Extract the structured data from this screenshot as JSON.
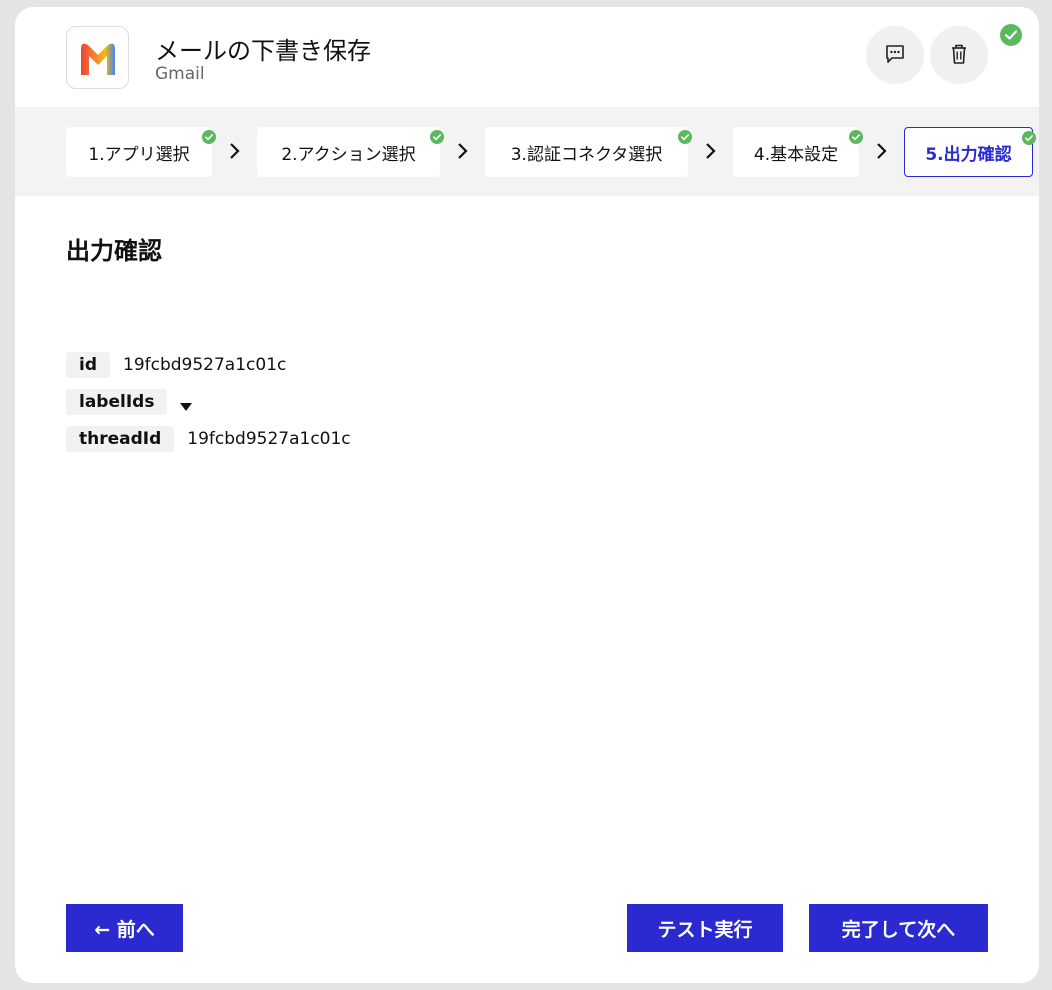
{
  "header": {
    "title": "メールの下書き保存",
    "subtitle": "Gmail",
    "logo_icon": "gmail-logo",
    "comment_icon": "comment-icon",
    "trash_icon": "trash-icon",
    "status_color": "#5cb85c"
  },
  "steps": [
    {
      "label": "1.アプリ選択",
      "done": true
    },
    {
      "label": "2.アクション選択",
      "done": true
    },
    {
      "label": "3.認証コネクタ選択",
      "done": true
    },
    {
      "label": "4.基本設定",
      "done": true
    },
    {
      "label": "5.出力確認",
      "done": true,
      "active": true
    }
  ],
  "main": {
    "section_title": "出力確認",
    "fields": [
      {
        "key": "id",
        "value": "19fcbd9527a1c01c"
      },
      {
        "key": "labelIds",
        "value": ""
      },
      {
        "key": "threadId",
        "value": "19fcbd9527a1c01c"
      }
    ]
  },
  "footer": {
    "prev_label": "← 前へ",
    "test_label": "テスト実行",
    "next_label": "完了して次へ"
  },
  "colors": {
    "accent": "#2a2ad0",
    "check": "#5cb85c"
  }
}
